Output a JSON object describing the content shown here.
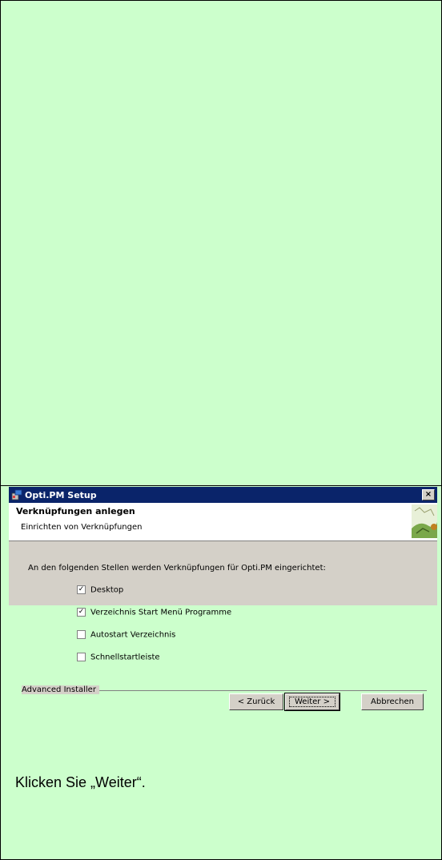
{
  "window": {
    "title": "Opti.PM Setup",
    "close_label": "×"
  },
  "header": {
    "title": "Verknüpfungen anlegen",
    "subtitle": "Einrichten von Verknüpfungen"
  },
  "body": {
    "intro": "An den folgenden Stellen werden Verknüpfungen für Opti.PM eingerichtet:",
    "options": [
      {
        "label": "Desktop",
        "checked": true
      },
      {
        "label": "Verzeichnis Start Menü Programme",
        "checked": true
      },
      {
        "label": "Autostart Verzeichnis",
        "checked": false
      },
      {
        "label": "Schnellstartleiste",
        "checked": false
      }
    ]
  },
  "footer": {
    "brand": "Advanced Installer",
    "back_label": "< Zurück",
    "next_label": "Weiter >",
    "cancel_label": "Abbrechen"
  },
  "caption": "Klicken Sie „Weiter“.",
  "colors": {
    "page_bg": "#ccffcc",
    "titlebar": "#0a246a",
    "dialog": "#d4d0c8"
  }
}
